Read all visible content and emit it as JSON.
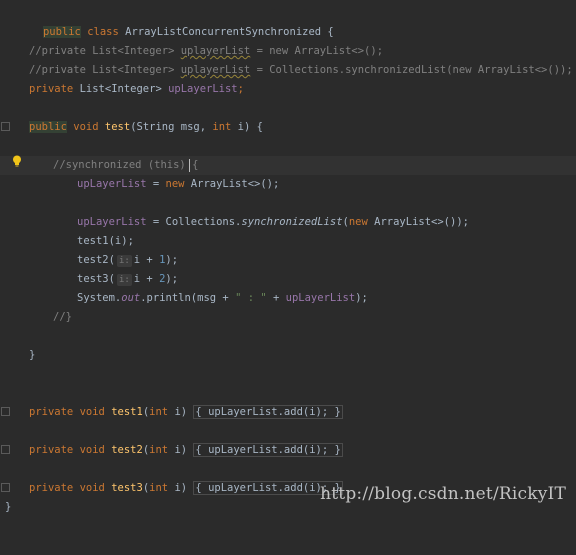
{
  "editor": {
    "lines": {
      "l1": {
        "kw1": "public",
        "kw2": "class",
        "name": "ArrayListConcurrentSynchronized",
        "brace": " {"
      },
      "l3": {
        "text": "//private List<Integer> ",
        "warn": "uplayerList",
        "rest": " = new ArrayList<>();"
      },
      "l4": {
        "text": "//private List<Integer> ",
        "warn": "uplayerList",
        "rest": " = Collections.synchronizedList(new ArrayList<>());"
      },
      "l5": {
        "kw": "private",
        "type": " List<Integer> ",
        "field": "upLayerList",
        "end": ";"
      },
      "l7": {
        "kw1": "public",
        "kw2": "void",
        "fn": "test",
        "open": "(String msg, ",
        "kw3": "int",
        "close": " i) {"
      },
      "l9": {
        "text": "//synchronized (this) {"
      },
      "l10": {
        "field": "upLayerList",
        "mid": " = ",
        "kw": "new",
        "rest": " ArrayList<>();"
      },
      "l12": {
        "field": "upLayerList",
        "mid": " = Collections.",
        "method": "synchronizedList",
        "open": "(",
        "kw": "new",
        "rest": " ArrayList<>());"
      },
      "l13": {
        "text": "test1(i);"
      },
      "l14": {
        "fn": "test2",
        "hint": "i:",
        "rest": "i + ",
        "num": "1",
        "end": ");"
      },
      "l15": {
        "fn": "test3",
        "hint": "i:",
        "rest": "i + ",
        "num": "2",
        "end": ");"
      },
      "l16": {
        "a": "System.",
        "out": "out",
        "b": ".println(msg + ",
        "str": "\" : \"",
        "c": " + ",
        "field": "upLayerList",
        "end": ");"
      },
      "l17": {
        "text": "//}"
      },
      "l19": {
        "text": "}"
      },
      "l22": {
        "kw1": "private",
        "kw2": "void",
        "fn": "test1",
        "open": "(",
        "kw3": "int",
        "close": " i) ",
        "inner": "{ upLayerList.add(i); }"
      },
      "l24": {
        "kw1": "private",
        "kw2": "void",
        "fn": "test2",
        "open": "(",
        "kw3": "int",
        "close": " i) ",
        "inner": "{ upLayerList.add(i); }"
      },
      "l26": {
        "kw1": "private",
        "kw2": "void",
        "fn": "test3",
        "open": "(",
        "kw3": "int",
        "close": " i) ",
        "inner": "{ upLayerList.add(i); }"
      },
      "l27": {
        "text": "}"
      }
    }
  },
  "watermark": "http://blog.csdn.net/RickyIT",
  "colors": {
    "background": "#2b2b2b",
    "keyword": "#cc7832",
    "comment": "#808080",
    "field": "#9876aa",
    "function": "#ffc66d",
    "number": "#6897bb",
    "string": "#6a8759",
    "text": "#a9b7c6"
  },
  "icons": {
    "bulb": "lightbulb-icon",
    "fold": "fold-marker-icon"
  }
}
